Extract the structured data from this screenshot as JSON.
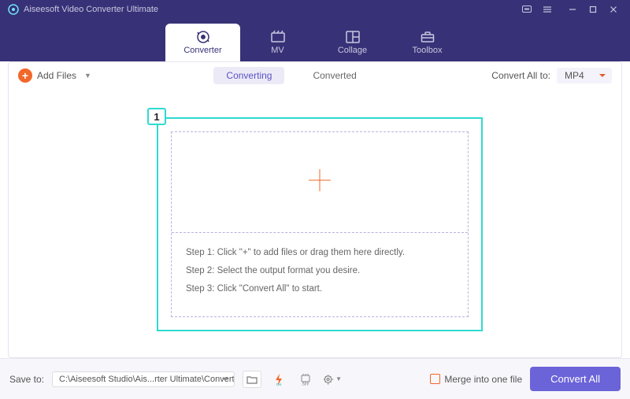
{
  "app": {
    "title": "Aiseesoft Video Converter Ultimate"
  },
  "tabs": [
    {
      "label": "Converter"
    },
    {
      "label": "MV"
    },
    {
      "label": "Collage"
    },
    {
      "label": "Toolbox"
    }
  ],
  "toolbar": {
    "add_label": "Add Files",
    "seg_converting": "Converting",
    "seg_converted": "Converted",
    "convert_all_to": "Convert All to:",
    "format": "MP4"
  },
  "callout": {
    "num": "1"
  },
  "steps": {
    "s1": "Step 1: Click \"+\" to add files or drag them here directly.",
    "s2": "Step 2: Select the output format you desire.",
    "s3": "Step 3: Click \"Convert All\" to start."
  },
  "bottom": {
    "save_to": "Save to:",
    "path": "C:\\Aiseesoft Studio\\Ais...rter Ultimate\\Converted",
    "merge": "Merge into one file",
    "convert_all": "Convert All"
  }
}
